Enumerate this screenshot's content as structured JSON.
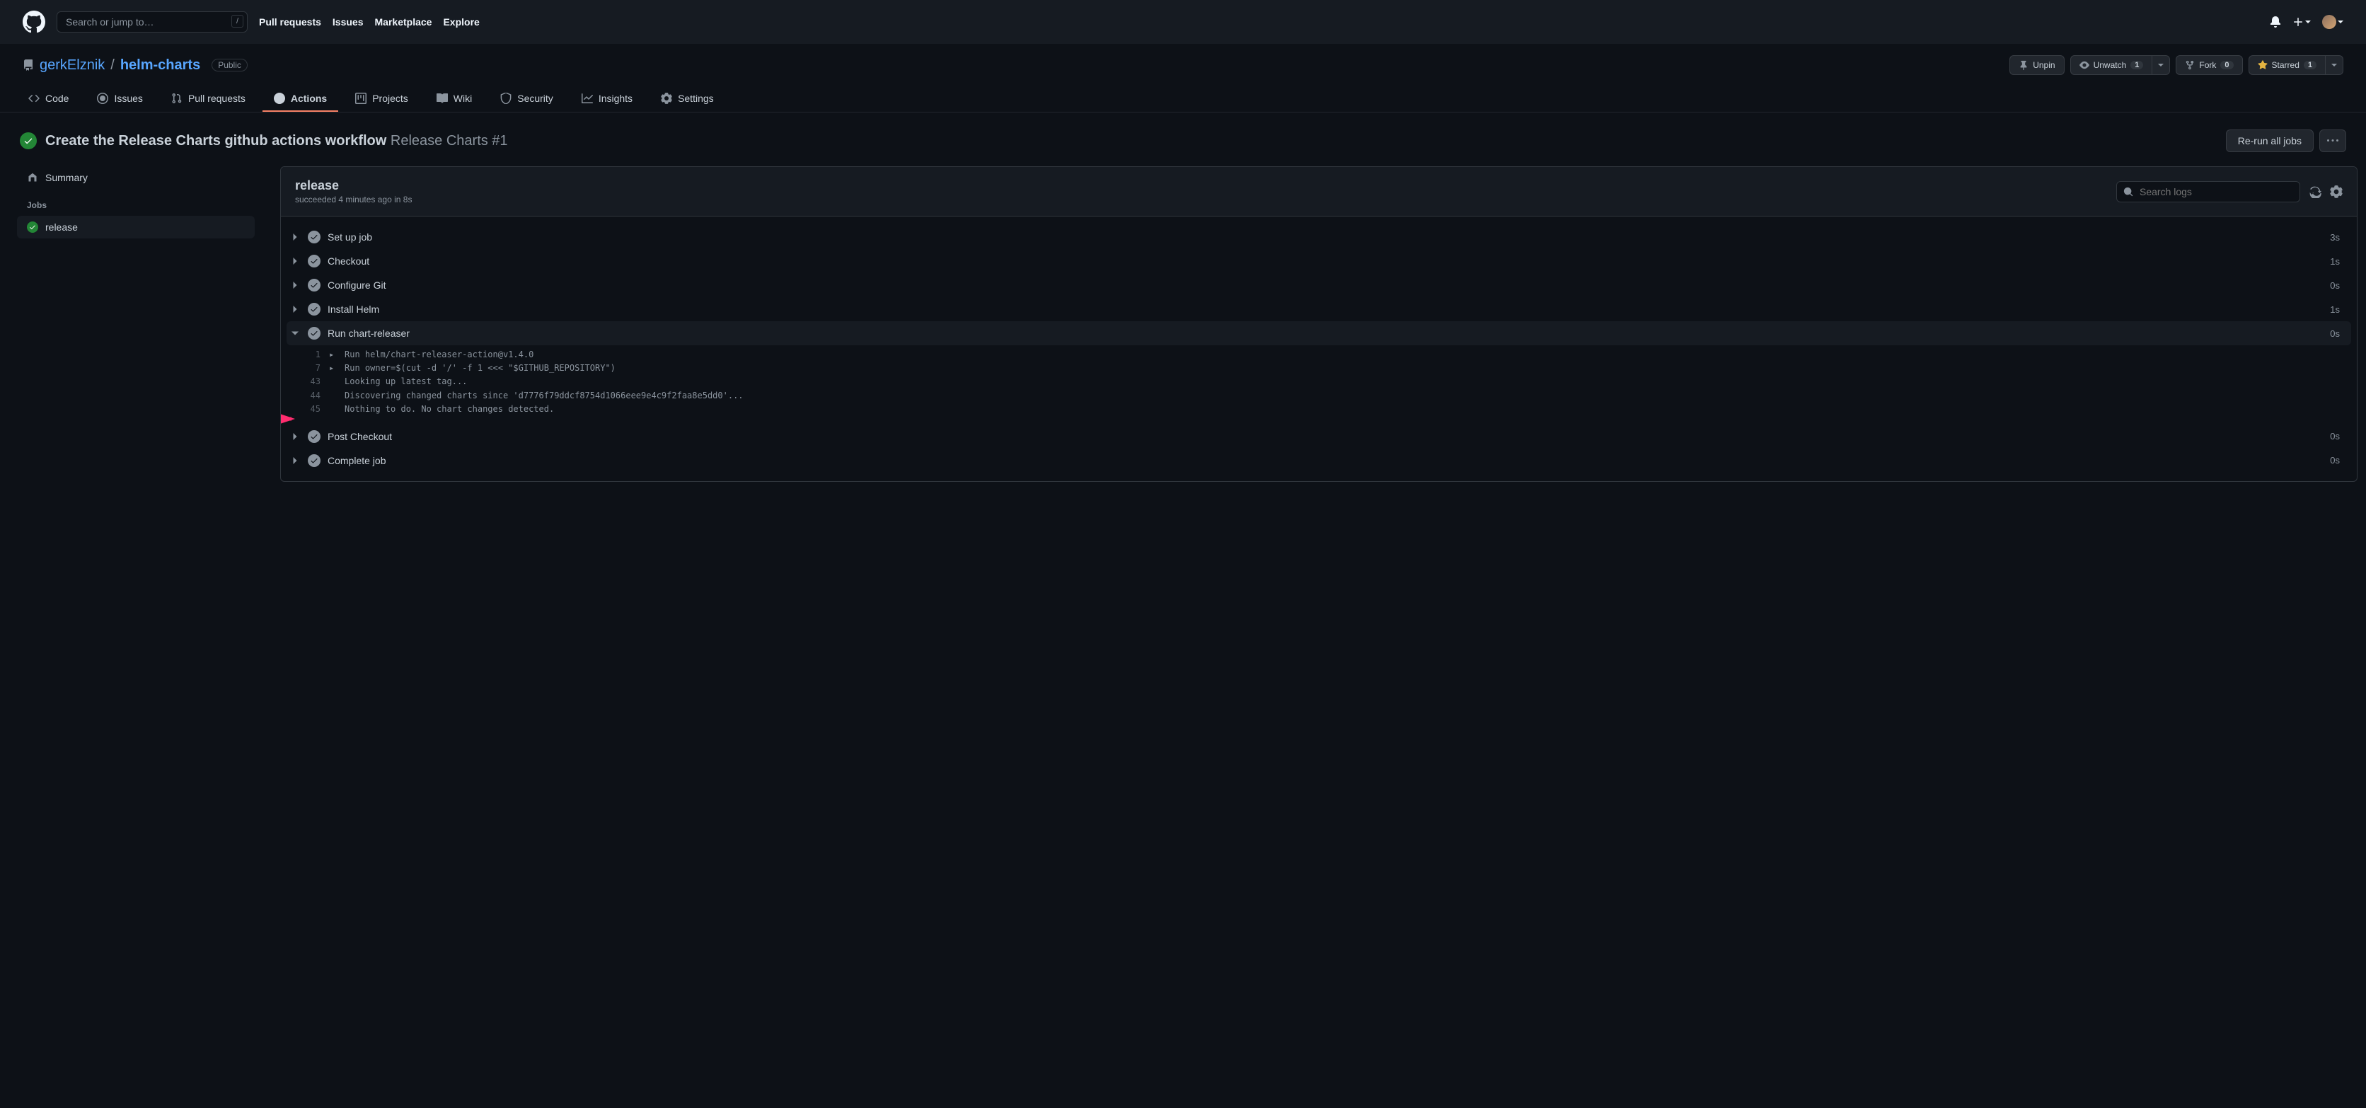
{
  "header": {
    "search_placeholder": "Search or jump to…",
    "slash_hint": "/",
    "nav": [
      "Pull requests",
      "Issues",
      "Marketplace",
      "Explore"
    ]
  },
  "repo": {
    "owner": "gerkElznik",
    "name": "helm-charts",
    "visibility": "Public",
    "actions": {
      "unpin": "Unpin",
      "unwatch": "Unwatch",
      "unwatch_count": "1",
      "fork": "Fork",
      "fork_count": "0",
      "starred": "Starred",
      "starred_count": "1"
    }
  },
  "tabs": [
    "Code",
    "Issues",
    "Pull requests",
    "Actions",
    "Projects",
    "Wiki",
    "Security",
    "Insights",
    "Settings"
  ],
  "workflow": {
    "title_main": "Create the Release Charts github actions workflow",
    "title_sub": "Release Charts #1",
    "rerun": "Re-run all jobs"
  },
  "sidebar": {
    "summary": "Summary",
    "jobs_label": "Jobs",
    "jobs": [
      "release"
    ]
  },
  "job": {
    "name": "release",
    "meta": "succeeded 4 minutes ago in 8s",
    "search_placeholder": "Search logs"
  },
  "steps": [
    {
      "name": "Set up job",
      "time": "3s",
      "expanded": false
    },
    {
      "name": "Checkout",
      "time": "1s",
      "expanded": false
    },
    {
      "name": "Configure Git",
      "time": "0s",
      "expanded": false
    },
    {
      "name": "Install Helm",
      "time": "1s",
      "expanded": false
    },
    {
      "name": "Run chart-releaser",
      "time": "0s",
      "expanded": true
    },
    {
      "name": "Post Checkout",
      "time": "0s",
      "expanded": false
    },
    {
      "name": "Complete job",
      "time": "0s",
      "expanded": false
    }
  ],
  "log_lines": [
    {
      "ln": "1",
      "arrow": "▸",
      "txt": "Run helm/chart-releaser-action@v1.4.0"
    },
    {
      "ln": "7",
      "arrow": "▸",
      "txt": "Run owner=$(cut -d '/' -f 1 <<< \"$GITHUB_REPOSITORY\")"
    },
    {
      "ln": "43",
      "arrow": "",
      "txt": "Looking up latest tag..."
    },
    {
      "ln": "44",
      "arrow": "",
      "txt": "Discovering changed charts since 'd7776f79ddcf8754d1066eee9e4c9f2faa8e5dd0'..."
    },
    {
      "ln": "45",
      "arrow": "",
      "txt": "Nothing to do. No chart changes detected."
    }
  ]
}
